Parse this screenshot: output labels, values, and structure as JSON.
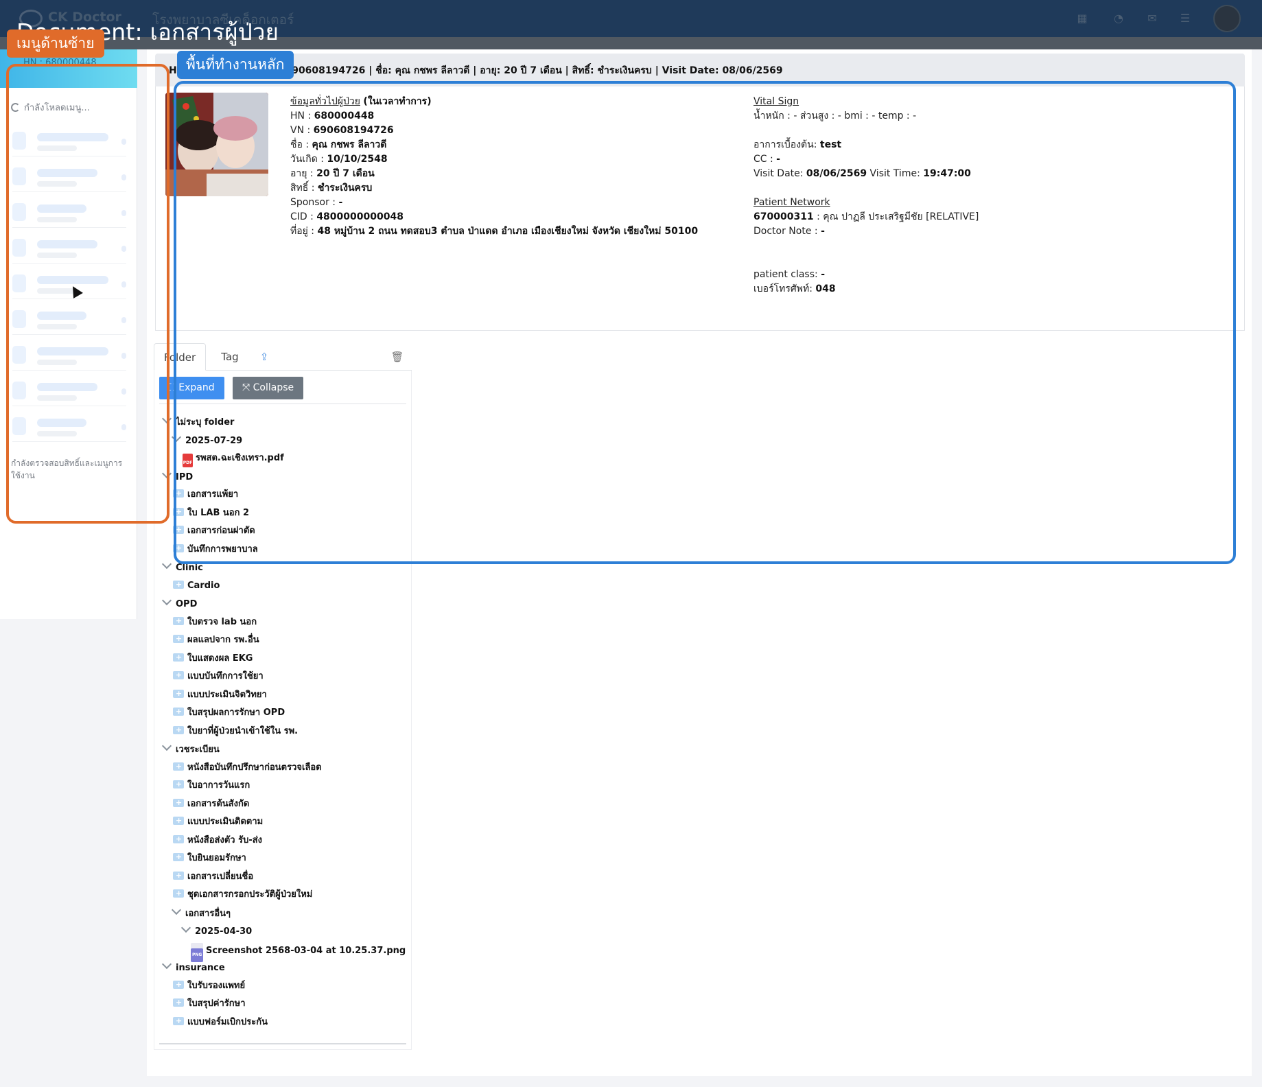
{
  "doc_title": "Document: เอกสารผู้ป่วย",
  "topbar": {
    "brand": "CK Doctor",
    "hospital": "โรงพยาบาลซีเคด็อกเตอร์"
  },
  "annotations": {
    "left_menu": "เมนูด้านซ้าย",
    "main_area": "พื้นที่ทำงานหลัก"
  },
  "sidebar": {
    "hn_line": "HN : 680000448",
    "loading": "กำลังโหลดเมนู...",
    "checking": "กำลังตรวจสอบสิทธิ์และเมนูการใช้งาน"
  },
  "header_line": "HN: 680000448 | VN: 690608194726 | ชื่อ: คุณ กชพร ลีลาวดี | อายุ: 20 ปี 7 เดือน | สิทธิ์: ชำระเงินครบ | Visit Date: 08/06/2569",
  "patient": {
    "section_title": "ข้อมูลทั่วไปผู้ป่วย",
    "section_note": "(ในเวลาทำการ)",
    "hn_label": "HN : ",
    "hn": "680000448",
    "vn_label": "VN : ",
    "vn": "690608194726",
    "name_label": "ชื่อ : ",
    "name": "คุณ กชพร ลีลาวดี",
    "dob_label": "วันเกิด : ",
    "dob": "10/10/2548",
    "age_label": "อายุ : ",
    "age": "20 ปี 7 เดือน",
    "right_label": "สิทธิ์ : ",
    "right": "ชำระเงินครบ",
    "sponsor_label": "Sponsor : ",
    "sponsor": "-",
    "cid_label": "CID : ",
    "cid": "4800000000048",
    "addr_label": "ที่อยู่ : ",
    "addr": "48 หมู่บ้าน 2 ถนน ทดสอบ3 ตำบล ป่าแดด อำเภอ เมืองเชียงใหม่ จังหวัด เชียงใหม่ 50100"
  },
  "vitals": {
    "title": "Vital Sign",
    "line": "น้ำหนัก : - ส่วนสูง : - bmi : - temp : -",
    "chief_label": "อาการเบื้องต้น: ",
    "chief": "test",
    "cc_label": "CC : ",
    "cc": "-",
    "visit_date_label": "Visit Date: ",
    "visit_date": "08/06/2569",
    "visit_time_label": " Visit Time: ",
    "visit_time": "19:47:00",
    "network_title": "Patient Network",
    "network_id": "670000311",
    "network_text": " : คุณ ปาฏลี ประเสริฐมีชัย [RELATIVE]",
    "doctor_note_label": "Doctor Note :  ",
    "doctor_note": "-",
    "class_label": "patient class: ",
    "class": "-",
    "phone_label": "เบอร์โทรศัพท์: ",
    "phone": "048"
  },
  "tabs": {
    "folder": "Folder",
    "tag": "Tag"
  },
  "buttons": {
    "expand": "Expand",
    "collapse": "Collapse"
  },
  "tree": [
    {
      "label": "ไม่ระบุ folder",
      "kind": "group"
    },
    {
      "label": "2025-07-29",
      "kind": "date"
    },
    {
      "label": "รพสต.ฉะเชิงเทรา.pdf",
      "kind": "pdf"
    },
    {
      "label": "IPD",
      "kind": "group"
    },
    {
      "label": "เอกสารแพ้ยา",
      "kind": "folder"
    },
    {
      "label": "ใบ LAB นอก 2",
      "kind": "folder"
    },
    {
      "label": "เอกสารก่อนผ่าตัด",
      "kind": "folder"
    },
    {
      "label": "บันทึกการพยาบาล",
      "kind": "folder"
    },
    {
      "label": "Clinic",
      "kind": "group"
    },
    {
      "label": "Cardio",
      "kind": "folder"
    },
    {
      "label": "OPD",
      "kind": "group"
    },
    {
      "label": "ใบตรวจ lab นอก",
      "kind": "folder"
    },
    {
      "label": "ผลแลปจาก รพ.อื่น",
      "kind": "folder"
    },
    {
      "label": "ใบแสดงผล EKG",
      "kind": "folder"
    },
    {
      "label": "แบบบันทึกการใช้ยา",
      "kind": "folder"
    },
    {
      "label": "แบบประเมินจิตวิทยา",
      "kind": "folder"
    },
    {
      "label": "ใบสรุปผลการรักษา OPD",
      "kind": "folder"
    },
    {
      "label": "ใบยาที่ผู้ป่วยนำเข้าใช้ใน รพ.",
      "kind": "folder"
    },
    {
      "label": "เวชระเบียน",
      "kind": "group"
    },
    {
      "label": "หนังสือบันทึกปรึกษาก่อนตรวจเลือด",
      "kind": "folder"
    },
    {
      "label": "ใบอาการวันแรก",
      "kind": "folder"
    },
    {
      "label": "เอกสารต้นสังกัด",
      "kind": "folder"
    },
    {
      "label": "แบบประเมินติดตาม",
      "kind": "folder"
    },
    {
      "label": "หนังสือส่งตัว รับ-ส่ง",
      "kind": "folder"
    },
    {
      "label": "ใบยินยอมรักษา",
      "kind": "folder"
    },
    {
      "label": "เอกสารเปลี่ยนชื่อ",
      "kind": "folder"
    },
    {
      "label": "ชุดเอกสารกรอกประวัติผู้ป่วยใหม่",
      "kind": "folder"
    },
    {
      "label": "เอกสารอื่นๆ",
      "kind": "subgroup"
    },
    {
      "label": "2025-04-30",
      "kind": "date2"
    },
    {
      "label": "Screenshot 2568-03-04 at 10.25.37.png",
      "kind": "png"
    },
    {
      "label": "insurance",
      "kind": "group"
    },
    {
      "label": "ใบรับรองแพทย์",
      "kind": "folder"
    },
    {
      "label": "ใบสรุปค่ารักษา",
      "kind": "folder"
    },
    {
      "label": "แบบฟอร์มเบิกประกัน",
      "kind": "folder"
    }
  ]
}
